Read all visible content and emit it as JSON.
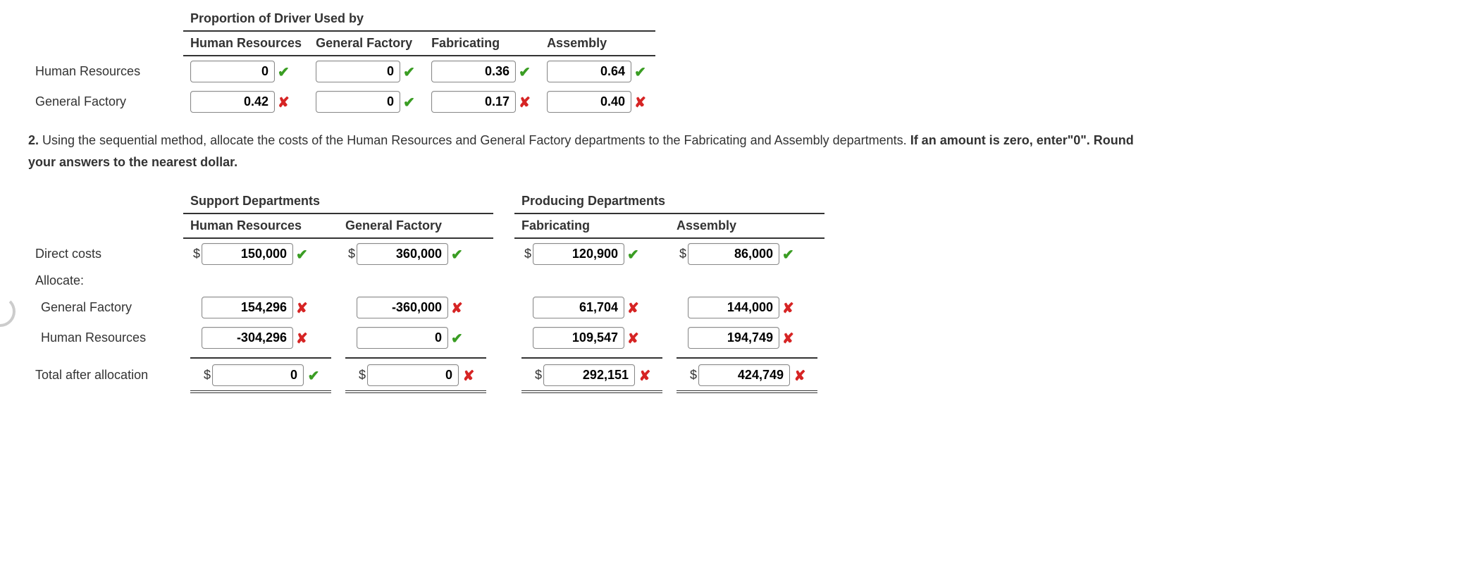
{
  "table1": {
    "super_header": "Proportion of Driver Used by",
    "columns": [
      "Human Resources",
      "General Factory",
      "Fabricating",
      "Assembly"
    ],
    "rows": [
      {
        "label": "Human Resources",
        "cells": [
          {
            "value": "0",
            "mark": "correct"
          },
          {
            "value": "0",
            "mark": "correct"
          },
          {
            "value": "0.36",
            "mark": "correct"
          },
          {
            "value": "0.64",
            "mark": "correct"
          }
        ]
      },
      {
        "label": "General Factory",
        "cells": [
          {
            "value": "0.42",
            "mark": "wrong"
          },
          {
            "value": "0",
            "mark": "correct"
          },
          {
            "value": "0.17",
            "mark": "wrong"
          },
          {
            "value": "0.40",
            "mark": "wrong"
          }
        ]
      }
    ]
  },
  "question": {
    "number": "2.",
    "text_a": " Using the sequential method, allocate the costs of the Human Resources and General Factory departments to the Fabricating and Assembly departments. ",
    "bold_tail": "If an amount is zero, enter\"0\". Round your answers to the nearest dollar."
  },
  "table2": {
    "group_headers": [
      "Support Departments",
      "Producing Departments"
    ],
    "columns": [
      "Human Resources",
      "General Factory",
      "Fabricating",
      "Assembly"
    ],
    "rows": [
      {
        "label": "Direct costs",
        "indent": false,
        "dollar": true,
        "cells": [
          {
            "value": "150,000",
            "mark": "correct"
          },
          {
            "value": "360,000",
            "mark": "correct"
          },
          {
            "value": "120,900",
            "mark": "correct"
          },
          {
            "value": "86,000",
            "mark": "correct"
          }
        ]
      },
      {
        "label": "Allocate:",
        "indent": false,
        "header_only": true
      },
      {
        "label": "General Factory",
        "indent": true,
        "dollar": false,
        "cells": [
          {
            "value": "154,296",
            "mark": "wrong"
          },
          {
            "value": "-360,000",
            "mark": "wrong"
          },
          {
            "value": "61,704",
            "mark": "wrong"
          },
          {
            "value": "144,000",
            "mark": "wrong"
          }
        ]
      },
      {
        "label": "Human Resources",
        "indent": true,
        "dollar": false,
        "cells": [
          {
            "value": "-304,296",
            "mark": "wrong"
          },
          {
            "value": "0",
            "mark": "correct"
          },
          {
            "value": "109,547",
            "mark": "wrong"
          },
          {
            "value": "194,749",
            "mark": "wrong"
          }
        ]
      },
      {
        "label": "Total after allocation",
        "indent": false,
        "dollar": true,
        "total": true,
        "cells": [
          {
            "value": "0",
            "mark": "correct"
          },
          {
            "value": "0",
            "mark": "wrong"
          },
          {
            "value": "292,151",
            "mark": "wrong"
          },
          {
            "value": "424,749",
            "mark": "wrong"
          }
        ]
      }
    ]
  },
  "marks": {
    "correct": "✔",
    "wrong": "✘"
  }
}
